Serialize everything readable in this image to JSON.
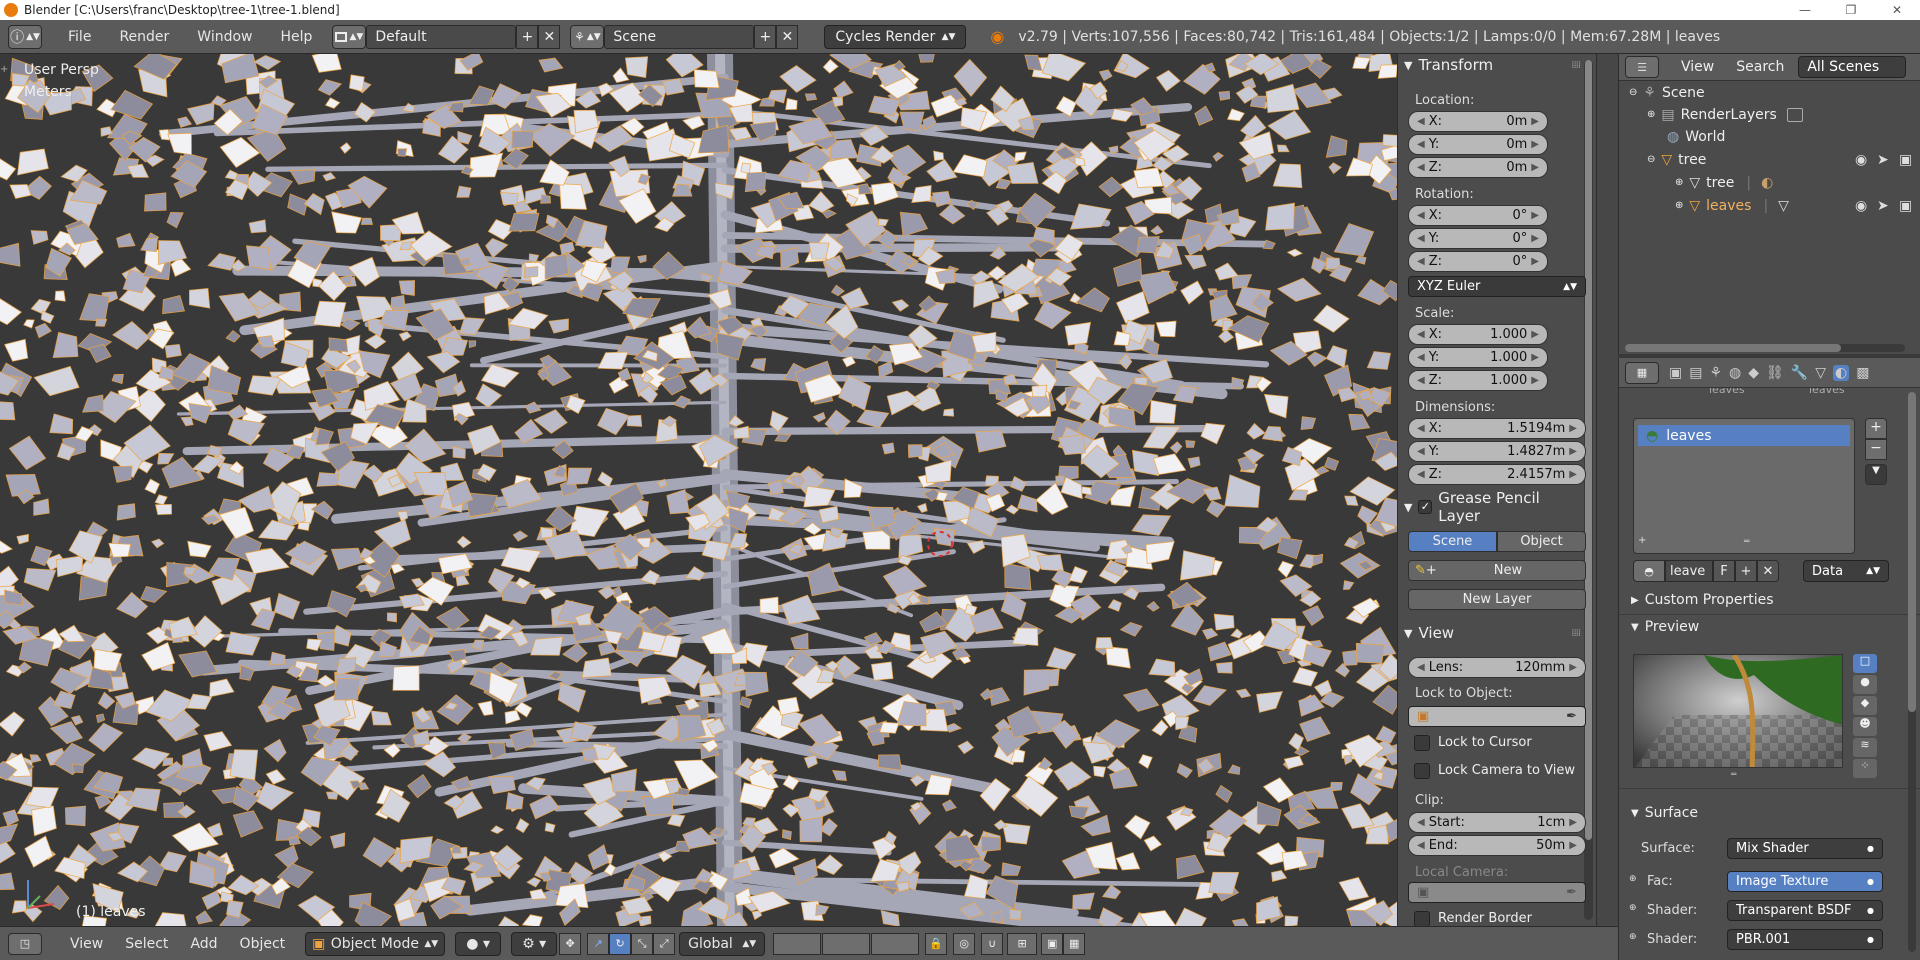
{
  "window": {
    "title": "Blender [C:\\Users\\franc\\Desktop\\tree-1\\tree-1.blend]",
    "minimize": "—",
    "restore": "❐",
    "close": "✕"
  },
  "topbar": {
    "info_icon": "ⓘ",
    "menus": [
      "File",
      "Render",
      "Window",
      "Help"
    ],
    "screen_layout": "Default",
    "scene": "Scene",
    "render_engine": "Cycles Render",
    "stats": "v2.79 | Verts:107,556 | Faces:80,742 | Tris:161,484 | Objects:1/2 | Lamps:0/0 | Mem:67.28M | leaves"
  },
  "viewport": {
    "view_name": "User Persp",
    "units": "Meters",
    "object_label": "(1) leaves",
    "background": "#393939"
  },
  "npanel": {
    "transform": {
      "title": "Transform",
      "location_label": "Location:",
      "location": [
        {
          "axis": "X:",
          "value": "0m"
        },
        {
          "axis": "Y:",
          "value": "0m"
        },
        {
          "axis": "Z:",
          "value": "0m"
        }
      ],
      "rotation_label": "Rotation:",
      "rotation": [
        {
          "axis": "X:",
          "value": "0°"
        },
        {
          "axis": "Y:",
          "value": "0°"
        },
        {
          "axis": "Z:",
          "value": "0°"
        }
      ],
      "rotation_mode": "XYZ Euler",
      "scale_label": "Scale:",
      "scale": [
        {
          "axis": "X:",
          "value": "1.000"
        },
        {
          "axis": "Y:",
          "value": "1.000"
        },
        {
          "axis": "Z:",
          "value": "1.000"
        }
      ],
      "dimensions_label": "Dimensions:",
      "dimensions": [
        {
          "axis": "X:",
          "value": "1.5194m"
        },
        {
          "axis": "Y:",
          "value": "1.4827m"
        },
        {
          "axis": "Z:",
          "value": "2.4157m"
        }
      ]
    },
    "grease_pencil": {
      "title": "Grease Pencil Layer",
      "scene_tab": "Scene",
      "object_tab": "Object",
      "new_label": "New",
      "new_layer": "New Layer"
    },
    "view": {
      "title": "View",
      "lens_label": "Lens:",
      "lens_value": "120mm",
      "lock_object_label": "Lock to Object:",
      "lock_cursor": "Lock to Cursor",
      "lock_camera": "Lock Camera to View",
      "clip_label": "Clip:",
      "clip_start_label": "Start:",
      "clip_start": "1cm",
      "clip_end_label": "End:",
      "clip_end": "50m",
      "local_camera": "Local Camera:",
      "render_border": "Render Border"
    }
  },
  "outliner": {
    "view_menu": "View",
    "search_menu": "Search",
    "filter": "All Scenes",
    "rows": [
      {
        "label": "Scene"
      },
      {
        "label": "RenderLayers"
      },
      {
        "label": "World"
      },
      {
        "label": "tree"
      },
      {
        "label": "tree"
      },
      {
        "label": "leaves"
      }
    ]
  },
  "properties": {
    "breadcrumb_left": "leaves",
    "breadcrumb_right": "leaves",
    "material_slot": "leaves",
    "material_name": "leave",
    "fake_user": "F",
    "link_mode": "Data",
    "custom_properties": "Custom Properties",
    "preview": "Preview",
    "surface_panel": "Surface",
    "surface_label": "Surface:",
    "surface_value": "Mix Shader",
    "fac_label": "Fac:",
    "fac_value": "Image Texture",
    "shader1_label": "Shader:",
    "shader1_value": "Transparent BSDF",
    "shader2_label": "Shader:",
    "shader2_value": "PBR.001"
  },
  "bottombar": {
    "menus": [
      "View",
      "Select",
      "Add",
      "Object"
    ],
    "mode": "Object Mode",
    "orientation": "Global"
  },
  "colors": {
    "accent_blue": "#5680c2",
    "selection_orange": "#f0a33c",
    "header_gray": "#5a5a5a",
    "panel_gray": "#4c4c4c"
  }
}
